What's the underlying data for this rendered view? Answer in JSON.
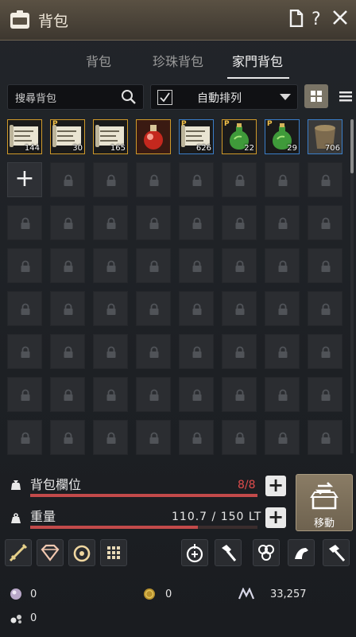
{
  "window": {
    "title": "背包"
  },
  "tabs": [
    {
      "label": "背包"
    },
    {
      "label": "珍珠背包"
    },
    {
      "label": "家門背包"
    }
  ],
  "search": {
    "placeholder": "搜尋背包"
  },
  "sort": {
    "label": "自動排列",
    "checked": true
  },
  "items": [
    {
      "icon": "scroll-icon",
      "count": "144",
      "premium": false,
      "border": "#d09a2a"
    },
    {
      "icon": "scroll-icon",
      "count": "30",
      "premium": true,
      "border": "#d09a2a"
    },
    {
      "icon": "scroll-icon",
      "count": "165",
      "premium": false,
      "border": "#d09a2a"
    },
    {
      "icon": "elixir-flask-icon",
      "count": "",
      "premium": false,
      "border": "#d09a2a"
    },
    {
      "icon": "scroll-icon",
      "count": "626",
      "premium": true,
      "border": "#3a7ec9"
    },
    {
      "icon": "green-potion-icon",
      "count": "22",
      "premium": true,
      "border": "#d09a2a"
    },
    {
      "icon": "green-potion-icon",
      "count": "29",
      "premium": true,
      "border": "#3a7ec9"
    },
    {
      "icon": "bucket-icon",
      "count": "706",
      "premium": false,
      "border": "#3a7ec9"
    }
  ],
  "slots": {
    "label": "背包欄位",
    "value": "8/8",
    "fraction": 1.0
  },
  "weight": {
    "label": "重量",
    "value": "110.7 / 150 LT",
    "fraction": 0.738
  },
  "move_button": {
    "label": "移動"
  },
  "currencies": {
    "pearl": "0",
    "gold": "0",
    "energy": "33,257",
    "other": "0"
  },
  "colors": {
    "accent": "#c24a4a",
    "item_gold": "#d09a2a",
    "item_blue": "#3a7ec9"
  }
}
